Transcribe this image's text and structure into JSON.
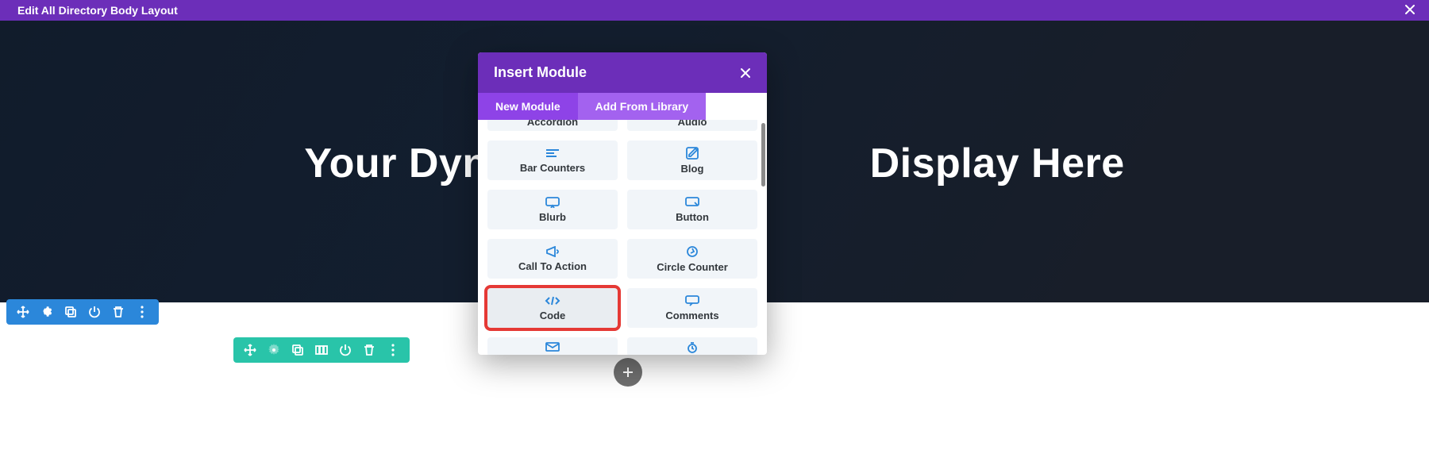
{
  "topbar": {
    "title": "Edit All Directory Body Layout"
  },
  "hero": {
    "title_left": "Your Dynami",
    "title_right": "Display Here"
  },
  "modal": {
    "title": "Insert Module",
    "tabs": {
      "new_module": "New Module",
      "add_from_library": "Add From Library"
    },
    "modules": {
      "accordion": "Accordion",
      "audio": "Audio",
      "bar_counters": "Bar Counters",
      "blog": "Blog",
      "blurb": "Blurb",
      "button": "Button",
      "cta": "Call To Action",
      "circle_counter": "Circle Counter",
      "code": "Code",
      "comments": "Comments"
    }
  },
  "icons": {
    "move": "move-icon",
    "gear": "gear-icon",
    "duplicate": "duplicate-icon",
    "power": "power-icon",
    "trash": "trash-icon",
    "more": "more-icon",
    "columns": "columns-icon"
  },
  "colors": {
    "purple": "#6c2eb9",
    "purple_light": "#8e43e7",
    "purple_lighter": "#a362ef",
    "blue": "#2b87da",
    "teal": "#29c4a9",
    "highlight": "#e53935"
  }
}
